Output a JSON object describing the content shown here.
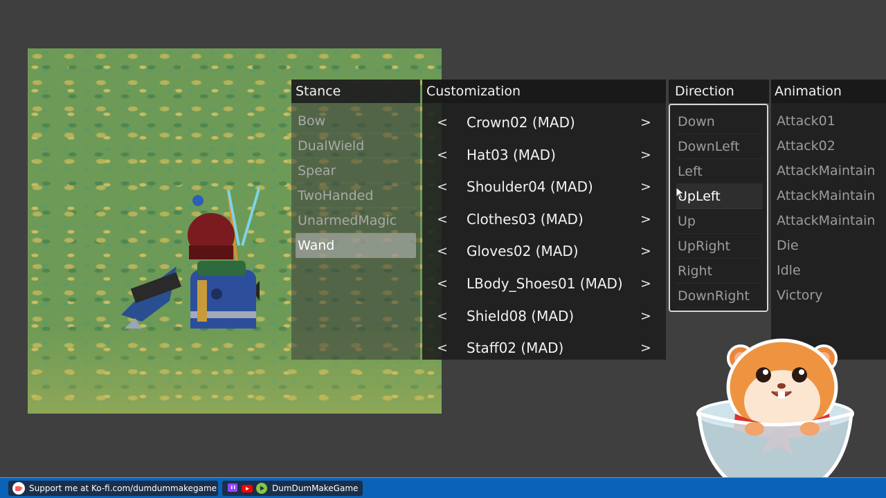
{
  "panel": {
    "stance": {
      "header": "Stance",
      "items": [
        "Bow",
        "DualWield",
        "Spear",
        "TwoHanded",
        "UnarmedMagic",
        "Wand"
      ],
      "selected": "Wand"
    },
    "customization": {
      "header": "Customization",
      "prev_label": "<",
      "next_label": ">",
      "rows": [
        "Crown02 (MAD)",
        "Hat03 (MAD)",
        "Shoulder04 (MAD)",
        "Clothes03 (MAD)",
        "Gloves02 (MAD)",
        "LBody_Shoes01 (MAD)",
        "Shield08 (MAD)",
        "Staff02 (MAD)"
      ]
    },
    "direction": {
      "header": "Direction",
      "items": [
        "Down",
        "DownLeft",
        "Left",
        "UpLeft",
        "Up",
        "UpRight",
        "Right",
        "DownRight"
      ],
      "hovered": "UpLeft"
    },
    "animation": {
      "header": "Animation",
      "items": [
        "Attack01",
        "Attack02",
        "AttackMaintain",
        "AttackMaintain",
        "AttackMaintain",
        "Die",
        "Idle",
        "Victory"
      ]
    }
  },
  "bottom_bar": {
    "kofi_text": "Support me at Ko-fi.com/dumdummakegame",
    "channel_name": "DumDumMakeGame",
    "icons": [
      "kofi-cup-icon",
      "twitch-icon",
      "youtube-icon",
      "rumble-icon"
    ]
  },
  "colors": {
    "background": "#3f3f3f",
    "panel": "#1e1e1e",
    "bar": "#0b63b7",
    "selected": "#bebebe"
  }
}
